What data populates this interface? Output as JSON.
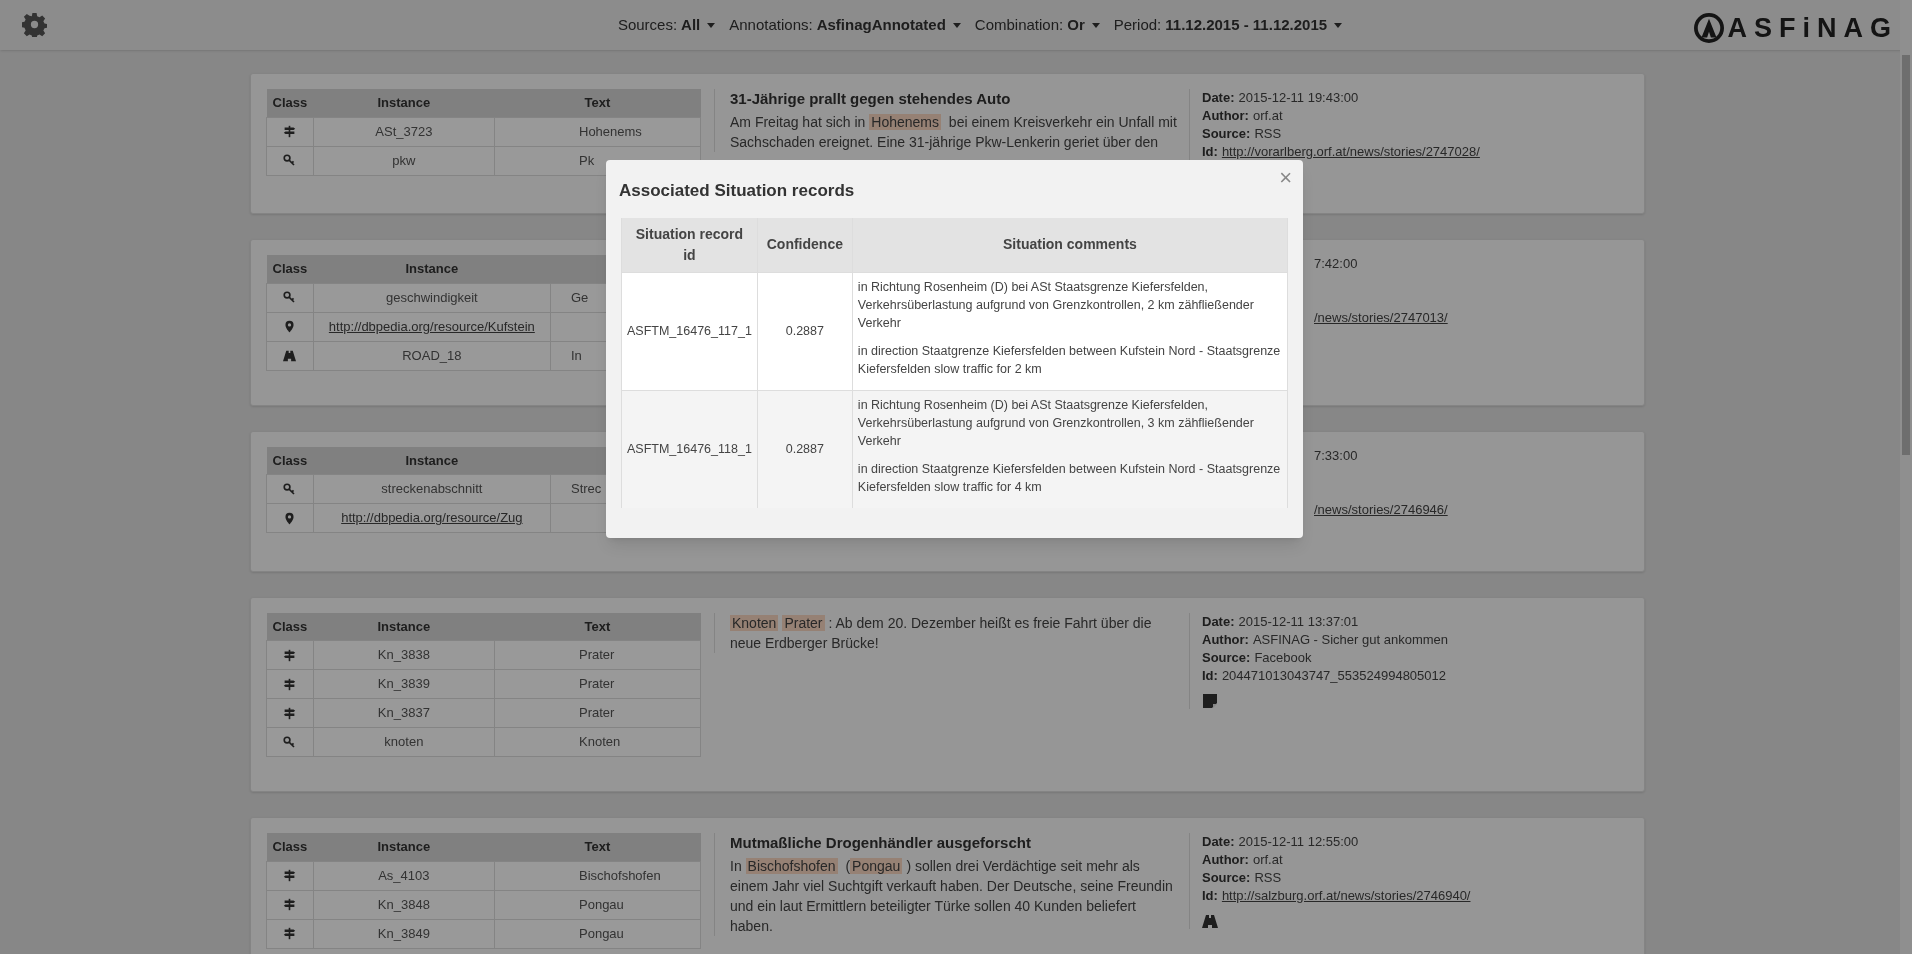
{
  "topbar": {
    "filters": [
      {
        "label": "Sources:",
        "value": "All"
      },
      {
        "label": "Annotations:",
        "value": "AsfinagAnnotated"
      },
      {
        "label": "Combination:",
        "value": "Or"
      },
      {
        "label": "Period:",
        "value": "11.12.2015 - 11.12.2015"
      }
    ],
    "logo": "ASFiNAG"
  },
  "cards": [
    {
      "kind": "full",
      "table": {
        "columns": [
          "Class",
          "Instance",
          "Text"
        ],
        "rows": [
          {
            "kind": "signpost",
            "instance": "ASt_3723",
            "text": "Hohenems"
          },
          {
            "kind": "key",
            "instance": "pkw",
            "text": "Pk"
          }
        ]
      },
      "article": {
        "title": "31-Jährige prallt gegen stehendes Auto",
        "body": [
          {
            "text": "Am Freitag hat sich in ",
            "highlight": false
          },
          {
            "text": "Hohenems",
            "highlight": true
          },
          {
            "text": " bei einem Kreisverkehr ein Unfall mit Sachschaden ereignet. Eine 31-jährige Pkw-Lenkerin geriet über den",
            "highlight": false
          }
        ]
      },
      "meta": [
        {
          "kind": "date",
          "label": "Date:",
          "value": "2015-12-11 19:43:00"
        },
        {
          "kind": "author",
          "label": "Author:",
          "value": "orf.at"
        },
        {
          "kind": "source",
          "label": "Source:",
          "value": "RSS"
        },
        {
          "kind": "id",
          "label": "Id:",
          "value": "http://vorarlberg.orf.at/news/stories/2747028/",
          "link": true
        }
      ]
    },
    {
      "kind": "covered",
      "table": {
        "columns": [
          "Class",
          "Instance"
        ],
        "rows": [
          {
            "kind": "key",
            "instance": "geschwindigkeit",
            "text": "Ge"
          },
          {
            "kind": "pin",
            "instance": "http://dbpedia.org/resource/Kufstein",
            "link": true
          },
          {
            "kind": "road",
            "instance": "ROAD_18",
            "text": "In"
          }
        ]
      },
      "meta": [
        {
          "kind": "date",
          "value": "7:42:00"
        },
        {
          "kind": "id",
          "value": "/news/stories/2747013/",
          "link": true
        }
      ]
    },
    {
      "kind": "covered",
      "table": {
        "columns": [
          "Class",
          "Instance"
        ],
        "rows": [
          {
            "kind": "key",
            "instance": "streckenabschnitt",
            "text": "Strec"
          },
          {
            "kind": "pin",
            "instance": "http://dbpedia.org/resource/Zug",
            "link": true
          }
        ]
      },
      "meta": [
        {
          "kind": "date",
          "value": "7:33:00"
        },
        {
          "kind": "id",
          "value": "/news/stories/2746946/",
          "link": true
        }
      ]
    },
    {
      "kind": "full",
      "table": {
        "columns": [
          "Class",
          "Instance",
          "Text"
        ],
        "rows": [
          {
            "kind": "signpost",
            "instance": "Kn_3838",
            "text": "Prater"
          },
          {
            "kind": "signpost",
            "instance": "Kn_3839",
            "text": "Prater"
          },
          {
            "kind": "signpost",
            "instance": "Kn_3837",
            "text": "Prater"
          },
          {
            "kind": "key",
            "instance": "knoten",
            "text": "Knoten"
          }
        ]
      },
      "article": {
        "body": [
          {
            "text": "Knoten",
            "highlight": true
          },
          {
            "text": "Prater",
            "highlight": true
          },
          {
            "text": ": Ab dem 20. Dezember heißt es freie Fahrt über die neue Erdberger Brücke!",
            "highlight": false
          }
        ]
      },
      "meta": [
        {
          "kind": "date",
          "label": "Date:",
          "value": "2015-12-11 13:37:01"
        },
        {
          "kind": "author",
          "label": "Author:",
          "value": "ASFINAG - Sicher gut ankommen"
        },
        {
          "kind": "source",
          "label": "Source:",
          "value": "Facebook"
        },
        {
          "kind": "id",
          "label": "Id:",
          "value": "204471013043747_553524994805012"
        }
      ],
      "meta_badge": {
        "kind": "note"
      }
    },
    {
      "kind": "full",
      "table": {
        "columns": [
          "Class",
          "Instance",
          "Text"
        ],
        "rows": [
          {
            "kind": "signpost",
            "instance": "As_4103",
            "text": "Bischofshofen"
          },
          {
            "kind": "signpost",
            "instance": "Kn_3848",
            "text": "Pongau"
          },
          {
            "kind": "signpost",
            "instance": "Kn_3849",
            "text": "Pongau"
          }
        ]
      },
      "article": {
        "title": "Mutmaßliche Drogenhändler ausgeforscht",
        "body": [
          {
            "text": "In ",
            "highlight": false
          },
          {
            "text": "Bischofshofen",
            "highlight": true
          },
          {
            "text": " (",
            "highlight": false
          },
          {
            "text": "Pongau",
            "highlight": true
          },
          {
            "text": ") sollen drei Verdächtige seit mehr als einem Jahr viel Suchtgift verkauft haben. Der Deutsche, seine Freundin und ein laut Ermittlern beteiligter Türke sollen 40 Kunden beliefert haben.",
            "highlight": false
          }
        ]
      },
      "meta": [
        {
          "kind": "date",
          "label": "Date:",
          "value": "2015-12-11 12:55:00"
        },
        {
          "kind": "author",
          "label": "Author:",
          "value": "orf.at"
        },
        {
          "kind": "source",
          "label": "Source:",
          "value": "RSS"
        },
        {
          "kind": "id",
          "label": "Id:",
          "value": "http://salzburg.orf.at/news/stories/2746940/",
          "link": true
        }
      ],
      "meta_badge": {
        "kind": "road"
      }
    }
  ],
  "modal": {
    "title": "Associated Situation records",
    "close": "×",
    "columns": [
      "Situation record id",
      "Confidence",
      "Situation comments"
    ],
    "rows": [
      {
        "id": "ASFTM_16476_117_1",
        "confidence": "0.2887",
        "comments": [
          "in Richtung Rosenheim (D) bei ASt Staatsgrenze Kiefersfelden, Verkehrsüberlastung aufgrund von Grenzkontrollen, 2 km zähfließender Verkehr",
          "in direction Staatgrenze Kiefersfelden between Kufstein Nord - Staatsgrenze Kiefersfelden slow traffic for 2 km"
        ]
      },
      {
        "id": "ASFTM_16476_118_1",
        "confidence": "0.2887",
        "comments": [
          "in Richtung Rosenheim (D) bei ASt Staatsgrenze Kiefersfelden, Verkehrsüberlastung aufgrund von Grenzkontrollen, 3 km zähfließender Verkehr",
          "in direction Staatgrenze Kiefersfelden between Kufstein Nord - Staatsgrenze Kiefersfelden slow traffic for 4 km"
        ]
      }
    ]
  }
}
